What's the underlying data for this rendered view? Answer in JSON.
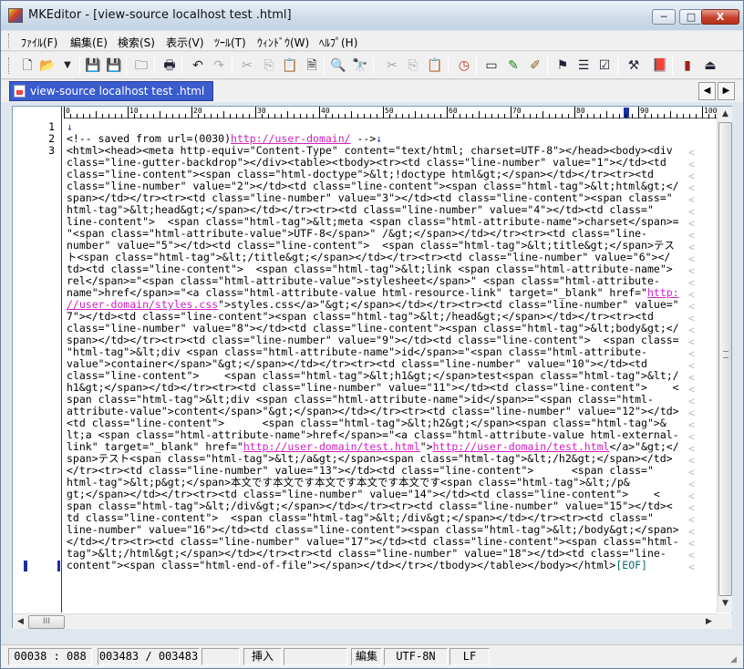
{
  "window": {
    "title": "MKEditor - [view-source localhost test .html]",
    "controls": {
      "minimize": "─",
      "maximize": "□",
      "close": "X"
    }
  },
  "menu": [
    "ﾌｧｲﾙ(F)",
    "編集(E)",
    "検索(S)",
    "表示(V)",
    "ﾂｰﾙ(T)",
    "ｳｨﾝﾄﾞｳ(W)",
    "ﾍﾙﾌﾟ(H)"
  ],
  "toolbar": {
    "icons": [
      "new-file-icon",
      "open-folder-icon",
      "dropdown-arrow-icon",
      "save-disabled-icon",
      "save-icon",
      "folder-icon",
      "print-icon",
      "undo-icon",
      "redo-icon",
      "cut-icon",
      "copy-icon",
      "paste-icon",
      "paste-special-icon",
      "find-icon",
      "find-next-icon",
      "cut2-icon",
      "copy2-icon",
      "paste2-icon",
      "clock-icon",
      "window-icon",
      "pen-icon",
      "marker-icon",
      "bookmark-icon",
      "list-icon",
      "check-icon",
      "tool-icon",
      "book-icon",
      "grep-icon",
      "run-icon"
    ]
  },
  "tabs": [
    {
      "label": "view-source localhost test .html",
      "active": true
    }
  ],
  "tab_nav": {
    "prev": "◀",
    "next": "▶"
  },
  "ruler": {
    "labels": [
      "0",
      "10",
      "20",
      "30",
      "40",
      "50",
      "60",
      "70",
      "80",
      "90",
      "100"
    ]
  },
  "editor": {
    "line_numbers": [
      "1",
      "2",
      "3"
    ],
    "newline_mark": "↓",
    "lines": [
      {
        "segments": [
          {
            "t": "↓",
            "c": "nl"
          }
        ]
      },
      {
        "segments": [
          {
            "t": "<!-- saved from url=(0030)"
          },
          {
            "t": "http://user-domain/",
            "c": "link"
          },
          {
            "t": " -->"
          },
          {
            "t": "↓",
            "c": "nl"
          }
        ]
      },
      {
        "segments": [
          {
            "t": "<html><head><meta http-equiv=\"Content-Type\" content=\"text/html; charset=UTF-8\"></head><body><div"
          }
        ]
      },
      {
        "segments": [
          {
            "t": "class=\"line-gutter-backdrop\"></div><table><tbody><tr><td class=\"line-number\" value=\"1\"></td><td"
          }
        ]
      },
      {
        "segments": [
          {
            "t": "class=\"line-content\"><span class=\"html-doctype\">&lt;!doctype html&gt;</span></td></tr><tr><td"
          }
        ]
      },
      {
        "segments": [
          {
            "t": "class=\"line-number\" value=\"2\"></td><td class=\"line-content\"><span class=\"html-tag\">&lt;html&gt;</"
          }
        ]
      },
      {
        "segments": [
          {
            "t": "span></td></tr><tr><td class=\"line-number\" value=\"3\"></td><td class=\"line-content\"><span class=\""
          }
        ]
      },
      {
        "segments": [
          {
            "t": "html-tag\">&lt;head&gt;</span></td></tr><tr><td class=\"line-number\" value=\"4\"></td><td class=\""
          }
        ]
      },
      {
        "segments": [
          {
            "t": "line-content\">  <span class=\"html-tag\">&lt;meta <span class=\"html-attribute-name\">charset</span>="
          }
        ]
      },
      {
        "segments": [
          {
            "t": "\"<span class=\"html-attribute-value\">UTF-8</span>\" /&gt;</span></td></tr><tr><td class=\"line-"
          }
        ]
      },
      {
        "segments": [
          {
            "t": "number\" value=\"5\"></td><td class=\"line-content\">  <span class=\"html-tag\">&lt;title&gt;</span>テス"
          }
        ]
      },
      {
        "segments": [
          {
            "t": "ト<span class=\"html-tag\">&lt;/title&gt;</span></td></tr><tr><td class=\"line-number\" value=\"6\"></"
          }
        ]
      },
      {
        "segments": [
          {
            "t": "td><td class=\"line-content\">  <span class=\"html-tag\">&lt;link <span class=\"html-attribute-name\">"
          }
        ]
      },
      {
        "segments": [
          {
            "t": "rel</span>=\"<span class=\"html-attribute-value\">stylesheet</span>\" <span class=\"html-attribute-"
          }
        ]
      },
      {
        "segments": [
          {
            "t": "name\">href</span>=\"<a class=\"html-attribute-value html-resource-link\" target=\"_blank\" href=\""
          },
          {
            "t": "http:",
            "c": "link"
          }
        ]
      },
      {
        "segments": [
          {
            "t": "//user-domain/styles.css",
            "c": "link"
          },
          {
            "t": "\">styles.css</a>\"&gt;</span></td></tr><tr><td class=\"line-number\" value=\""
          }
        ]
      },
      {
        "segments": [
          {
            "t": "7\"></td><td class=\"line-content\"><span class=\"html-tag\">&lt;/head&gt;</span></td></tr><tr><td"
          }
        ]
      },
      {
        "segments": [
          {
            "t": "class=\"line-number\" value=\"8\"></td><td class=\"line-content\"><span class=\"html-tag\">&lt;body&gt;</"
          }
        ]
      },
      {
        "segments": [
          {
            "t": "span></td></tr><tr><td class=\"line-number\" value=\"9\"></td><td class=\"line-content\">  <span class="
          }
        ]
      },
      {
        "segments": [
          {
            "t": "\"html-tag\">&lt;div <span class=\"html-attribute-name\">id</span>=\"<span class=\"html-attribute-"
          }
        ]
      },
      {
        "segments": [
          {
            "t": "value\">container</span>\"&gt;</span></td></tr><tr><td class=\"line-number\" value=\"10\"></td><td"
          }
        ]
      },
      {
        "segments": [
          {
            "t": "class=\"line-content\">    <span class=\"html-tag\">&lt;h1&gt;</span>test<span class=\"html-tag\">&lt;/"
          }
        ]
      },
      {
        "segments": [
          {
            "t": "h1&gt;</span></td></tr><tr><td class=\"line-number\" value=\"11\"></td><td class=\"line-content\">    <"
          }
        ]
      },
      {
        "segments": [
          {
            "t": "span class=\"html-tag\">&lt;div <span class=\"html-attribute-name\">id</span>=\"<span class=\"html-"
          }
        ]
      },
      {
        "segments": [
          {
            "t": "attribute-value\">content</span>\"&gt;</span></td></tr><tr><td class=\"line-number\" value=\"12\"></td>"
          }
        ]
      },
      {
        "segments": [
          {
            "t": "<td class=\"line-content\">      <span class=\"html-tag\">&lt;h2&gt;</span><span class=\"html-tag\">&"
          }
        ]
      },
      {
        "segments": [
          {
            "t": "lt;a <span class=\"html-attribute-name\">href</span>=\"<a class=\"html-attribute-value html-external-"
          }
        ]
      },
      {
        "segments": [
          {
            "t": "link\" target=\"_blank\" href=\""
          },
          {
            "t": "http://user-domain/test.html",
            "c": "link"
          },
          {
            "t": "\">"
          },
          {
            "t": "http://user-domain/test.html",
            "c": "link"
          },
          {
            "t": "</a>\"&gt;</"
          }
        ]
      },
      {
        "segments": [
          {
            "t": "span>テスト<span class=\"html-tag\">&lt;/a&gt;</span><span class=\"html-tag\">&lt;/h2&gt;</span></td>"
          }
        ]
      },
      {
        "segments": [
          {
            "t": "</tr><tr><td class=\"line-number\" value=\"13\"></td><td class=\"line-content\">      <span class=\""
          }
        ]
      },
      {
        "segments": [
          {
            "t": "html-tag\">&lt;p&gt;</span>本文です本文です本文です本文です本文です<span class=\"html-tag\">&lt;/p&"
          }
        ]
      },
      {
        "segments": [
          {
            "t": "gt;</span></td></tr><tr><td class=\"line-number\" value=\"14\"></td><td class=\"line-content\">    <"
          }
        ]
      },
      {
        "segments": [
          {
            "t": "span class=\"html-tag\">&lt;/div&gt;</span></td></tr><tr><td class=\"line-number\" value=\"15\"></td><"
          }
        ]
      },
      {
        "segments": [
          {
            "t": "td class=\"line-content\">  <span class=\"html-tag\">&lt;/div&gt;</span></td></tr><tr><td class=\""
          }
        ]
      },
      {
        "segments": [
          {
            "t": "line-number\" value=\"16\"></td><td class=\"line-content\"><span class=\"html-tag\">&lt;/body&gt;</span>"
          }
        ]
      },
      {
        "segments": [
          {
            "t": "</td></tr><tr><td class=\"line-number\" value=\"17\"></td><td class=\"line-content\"><span class=\"html-"
          }
        ]
      },
      {
        "segments": [
          {
            "t": "tag\">&lt;/html&gt;</span></td></tr><tr><td class=\"line-number\" value=\"18\"></td><td class=\"line-"
          }
        ]
      },
      {
        "segments": [
          {
            "t": "content\"><span class=\"html-end-of-file\"></span></td></tr></tbody></table></body></html>"
          },
          {
            "t": "[EOF]",
            "c": "eof"
          }
        ]
      }
    ]
  },
  "scroll": {
    "h_thumb_grip": "III"
  },
  "status": {
    "position": "00038 : 088",
    "chars": "003483 / 003483",
    "insert_mode": "挿入",
    "edit_mode": "編集",
    "encoding": "UTF-8N",
    "line_ending": "LF"
  },
  "colors": {
    "tab_active": "#3b5ccf",
    "link": "#d020c0",
    "newline_mark": "#2040c0",
    "eof": "#0d6a70",
    "close_button": "#c7422c"
  }
}
